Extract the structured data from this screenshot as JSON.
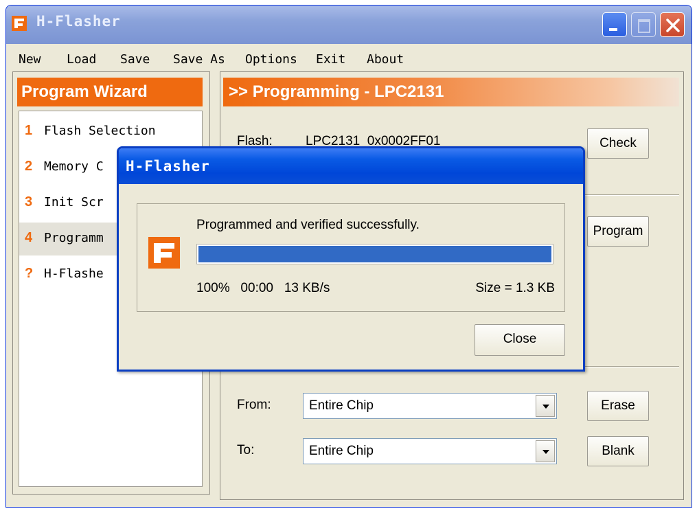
{
  "window": {
    "title": "H-Flasher"
  },
  "menu": [
    "New",
    "Load",
    "Save",
    "Save As",
    "Options",
    "Exit",
    "About"
  ],
  "wizard": {
    "header": "Program Wizard",
    "items": [
      {
        "num": "1",
        "label": "Flash Selection"
      },
      {
        "num": "2",
        "label": "Memory C"
      },
      {
        "num": "3",
        "label": "Init Scr"
      },
      {
        "num": "4",
        "label": "Programm"
      },
      {
        "num": "?",
        "label": "H-Flashe"
      }
    ]
  },
  "programming": {
    "header": ">> Programming - LPC2131",
    "flash_label": "Flash:",
    "flash_value": "LPC2131  0x0002FF01",
    "check_button": "Check",
    "program_button": "Program",
    "from_label": "From:",
    "from_value": "Entire Chip",
    "to_label": "To:",
    "to_value": "Entire Chip",
    "erase_button": "Erase",
    "blank_button": "Blank"
  },
  "dialog": {
    "title": "H-Flasher",
    "message": "Programmed and verified successfully.",
    "progress_percent": 100,
    "stats": "100%   00:00   13 KB/s",
    "size": "Size = 1.3 KB",
    "close_button": "Close"
  },
  "colors": {
    "accent_orange": "#ef6a10",
    "progress_blue": "#316ac5",
    "dialog_title_blue": "#0046d8"
  }
}
